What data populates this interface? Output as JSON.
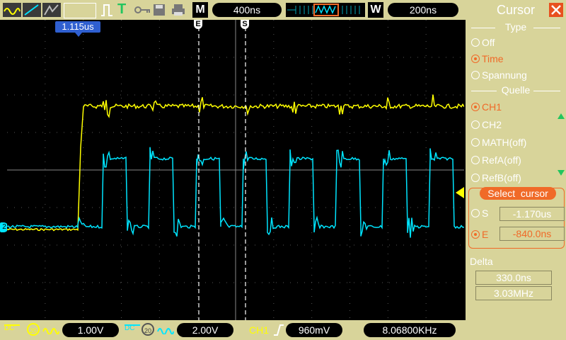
{
  "top": {
    "mode_label": "M",
    "main_timebase": "400ns",
    "window_label": "W",
    "window_timebase": "200ns"
  },
  "cursor_readout": "1.115us",
  "markers": {
    "end_label": "E",
    "start_label": "S"
  },
  "bottom": {
    "ch1_scale": "1.00V",
    "ch2_scale": "2.00V",
    "trigger_source": "CH1",
    "trigger_level": "960mV",
    "frequency": "8.06800KHz"
  },
  "panel": {
    "title": "Cursor",
    "type_header": "Type",
    "type_options": [
      "Off",
      "Time",
      "Spannung"
    ],
    "selected_type": "Time",
    "source_header": "Quelle",
    "source_options": [
      "CH1",
      "CH2",
      "MATH(off)",
      "RefA(off)",
      "RefB(off)"
    ],
    "selected_source": "CH1",
    "select_cursor_label": "Select  cursor",
    "s_label": "S",
    "s_value": "-1.170us",
    "e_label": "E",
    "e_value": "-840.0ns",
    "delta_label": "Delta",
    "delta_time": "330.0ns",
    "delta_freq": "3.03MHz"
  },
  "colors": {
    "ch1": "#ffff00",
    "ch2": "#00e5ff",
    "accent": "#f06a28",
    "panel_bg": "#d8d49a"
  },
  "ch2_marker_label": "2"
}
